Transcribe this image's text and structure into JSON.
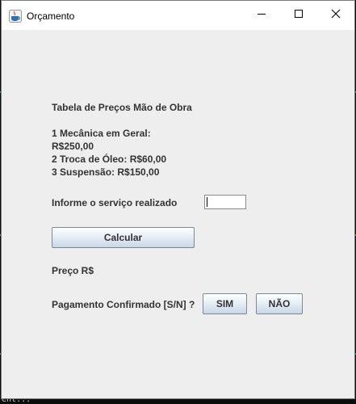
{
  "window": {
    "title": "Orçamento",
    "icon": "java-cup-icon"
  },
  "controls": {
    "minimize": "minimize-icon",
    "maximize": "maximize-icon",
    "close": "close-icon"
  },
  "form": {
    "table_title": "Tabela de Preços Mão de Obra",
    "item1_line1": "1 Mecânica em Geral:",
    "item1_line2": "R$250,00",
    "item2": "2 Troca de Óleo: R$60,00",
    "item3": "3 Suspensão: R$150,00",
    "service_prompt": "Informe o serviço realizado",
    "service_value": "",
    "calc_label": "Calcular",
    "price_label": "Preço R$",
    "payment_prompt": "Pagamento Confirmado [S/N] ?",
    "yes_label": "SIM",
    "no_label": "NÃO"
  },
  "background": {
    "console_fragment": "ent..."
  },
  "colors": {
    "window_bg": "#eeeeee",
    "titlebar_bg": "#ffffff",
    "label_text": "#333333",
    "console_bg": "#0c0c0c"
  }
}
